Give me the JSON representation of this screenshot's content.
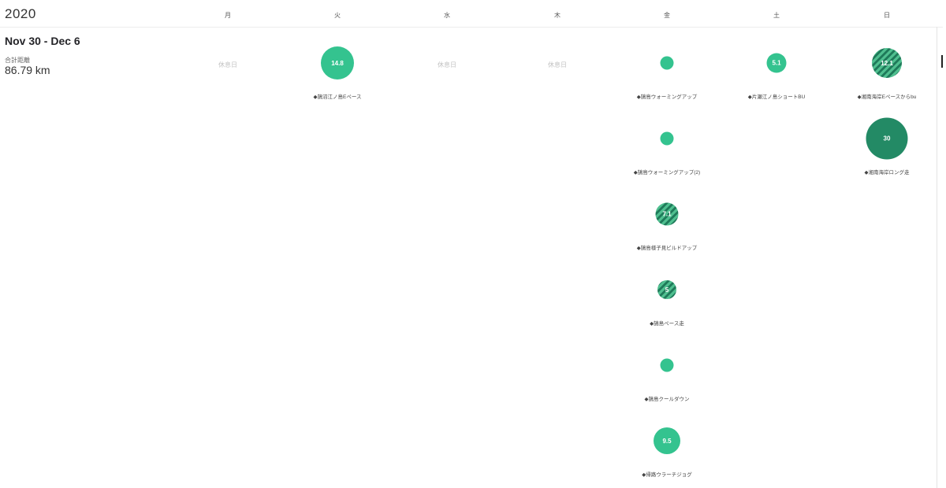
{
  "header": {
    "year": "2020",
    "days": [
      "月",
      "火",
      "水",
      "木",
      "金",
      "土",
      "日"
    ]
  },
  "week": {
    "range": "Nov 30 - Dec 6",
    "total_label": "合計距離",
    "total_value": "86.79 km",
    "rest_label": "休息日"
  },
  "colors": {
    "easy": "#34c38f",
    "hard": "#238a65",
    "stripe_light": "#4fbf8f",
    "stripe_dark": "#1f7a5a"
  },
  "activities": {
    "tue": [
      {
        "value": "14.8",
        "label": "◆鵠沼江ノ島Eペース",
        "style": "easy"
      }
    ],
    "fri": [
      {
        "value": "",
        "label": "◆鵠島ウォーミングアップ",
        "style": "easy"
      },
      {
        "value": "",
        "label": "◆鵠島ウォーミングアップ(2)",
        "style": "easy"
      },
      {
        "value": "7.1",
        "label": "◆鵠島様子見ビルドアップ",
        "style": "striped"
      },
      {
        "value": "5",
        "label": "◆鵠島ペース走",
        "style": "striped"
      },
      {
        "value": "",
        "label": "◆鵠島クールダウン",
        "style": "easy"
      },
      {
        "value": "9.5",
        "label": "◆帰路ウラーチジョグ",
        "style": "easy"
      }
    ],
    "sat": [
      {
        "value": "5.1",
        "label": "◆片瀬江ノ島ショートBU",
        "style": "easy"
      }
    ],
    "sun": [
      {
        "value": "12.1",
        "label": "◆湘南海岸Eペースからbu",
        "style": "striped"
      },
      {
        "value": "30",
        "label": "◆湘南海岸ロング走",
        "style": "hard"
      }
    ]
  }
}
